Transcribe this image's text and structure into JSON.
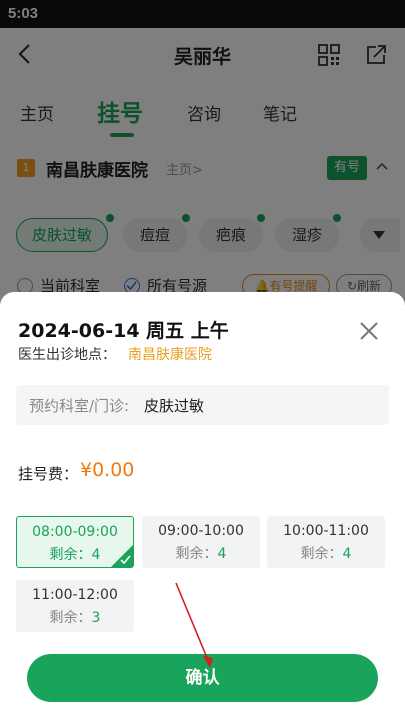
{
  "status_bar": {
    "time": "5:03"
  },
  "header": {
    "title": "吴丽华"
  },
  "tabs": [
    {
      "label": "主页"
    },
    {
      "label": "挂号"
    },
    {
      "label": "咨询"
    },
    {
      "label": "笔记"
    }
  ],
  "hospital": {
    "badge": "1",
    "name": "南昌肤康医院",
    "home_link": "主页>",
    "availability": "有号"
  },
  "chips": [
    {
      "label": "皮肤过敏"
    },
    {
      "label": "痘痘"
    },
    {
      "label": "疤痕"
    },
    {
      "label": "湿疹"
    }
  ],
  "filters": {
    "current_dept": "当前科室",
    "all_sources": "所有号源",
    "remind": "有号提醒",
    "refresh": "刷新"
  },
  "sheet": {
    "date": "2024-06-14 周五 上午",
    "location_label": "医生出诊地点：",
    "location_value": "南昌肤康医院",
    "dept_label": "预约科室/门诊:",
    "dept_value": "皮肤过敏",
    "fee_label": "挂号费：",
    "fee_value": "¥0.00",
    "remaining_label": "剩余：",
    "slots": [
      {
        "time": "08:00-09:00",
        "remaining": "4",
        "selected": true
      },
      {
        "time": "09:00-10:00",
        "remaining": "4",
        "selected": false
      },
      {
        "time": "10:00-11:00",
        "remaining": "4",
        "selected": false
      },
      {
        "time": "11:00-12:00",
        "remaining": "3",
        "selected": false
      }
    ],
    "confirm_label": "确认"
  },
  "colors": {
    "brand_green": "#1aa35a",
    "fee_orange": "#f07a12",
    "location_gold": "#e8a020"
  }
}
